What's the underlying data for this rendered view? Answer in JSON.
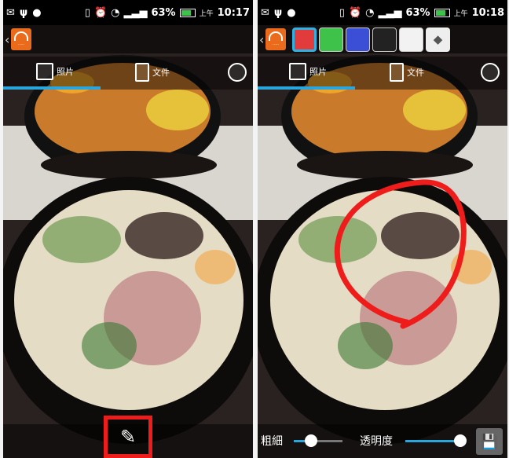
{
  "colors": {
    "accent": "#2aa6dd",
    "annotation_red": "#ef1c1c",
    "logo_orange": "#e96b1b"
  },
  "screens": [
    {
      "status": {
        "battery": "63%",
        "ampm": "上午",
        "time": "10:17"
      },
      "tabs": [
        {
          "label": "照片",
          "icon": "photo-icon"
        },
        {
          "label": "文件",
          "icon": "document-icon"
        },
        {
          "label": "",
          "icon": "globe-icon"
        }
      ],
      "pencil_icon": "pencil-icon"
    },
    {
      "status": {
        "battery": "63%",
        "ampm": "上午",
        "time": "10:18"
      },
      "tabs": [
        {
          "label": "照片",
          "icon": "photo-icon"
        },
        {
          "label": "文件",
          "icon": "document-icon"
        },
        {
          "label": "",
          "icon": "globe-icon"
        }
      ],
      "swatches": [
        "#e23b3b",
        "#3ec24a",
        "#3a4ed6",
        "#222222",
        "#f2f2f2"
      ],
      "controls": {
        "thickness_label": "粗細",
        "thickness_value": 0.35,
        "opacity_label": "透明度",
        "opacity_value": 0.95
      }
    }
  ]
}
